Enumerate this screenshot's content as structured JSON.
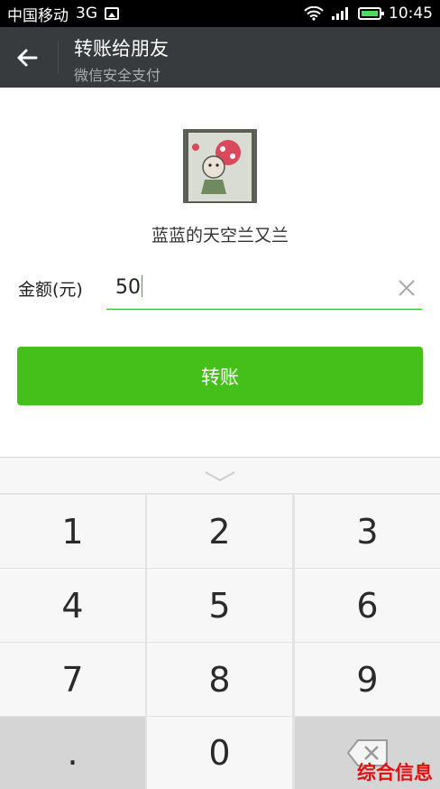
{
  "status_bar": {
    "carrier": "中国移动",
    "network": "3G",
    "time": "10:45"
  },
  "header": {
    "title": "转账给朋友",
    "subtitle": "微信安全支付"
  },
  "recipient": {
    "name": "蓝蓝的天空兰又兰"
  },
  "form": {
    "amount_label": "金额(元)",
    "amount_value": "50"
  },
  "actions": {
    "transfer_label": "转账"
  },
  "keypad": {
    "rows": [
      [
        "1",
        "2",
        "3"
      ],
      [
        "4",
        "5",
        "6"
      ],
      [
        "7",
        "8",
        "9"
      ],
      [
        ".",
        "0",
        ""
      ]
    ]
  },
  "watermark": "综合信息",
  "colors": {
    "accent": "#45c01a",
    "titlebar": "#373b3e",
    "watermark": "#e10f0f"
  }
}
